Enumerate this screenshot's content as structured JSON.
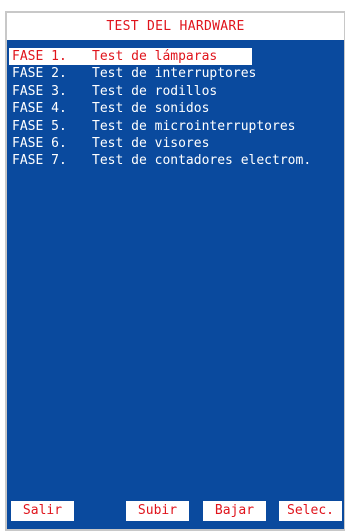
{
  "screen": {
    "title": "TEST DEL HARDWARE"
  },
  "menu": {
    "selected_index": 0,
    "items": [
      {
        "phase": "FASE 1.",
        "label": "Test de lámparas"
      },
      {
        "phase": "FASE 2.",
        "label": "Test de interruptores"
      },
      {
        "phase": "FASE 3.",
        "label": "Test de rodillos"
      },
      {
        "phase": "FASE 4.",
        "label": "Test de sonidos"
      },
      {
        "phase": "FASE 5.",
        "label": "Test de microinterruptores"
      },
      {
        "phase": "FASE 6.",
        "label": "Test de visores"
      },
      {
        "phase": "FASE 7.",
        "label": "Test de contadores electrom."
      }
    ]
  },
  "footer": {
    "exit_label": "Salir",
    "up_label": "Subir",
    "down_label": "Bajar",
    "select_label": "Selec."
  },
  "colors": {
    "background": "#0a4a9e",
    "highlight": "#ffffff",
    "accent_text": "#e0141c",
    "text": "#ffffff"
  }
}
